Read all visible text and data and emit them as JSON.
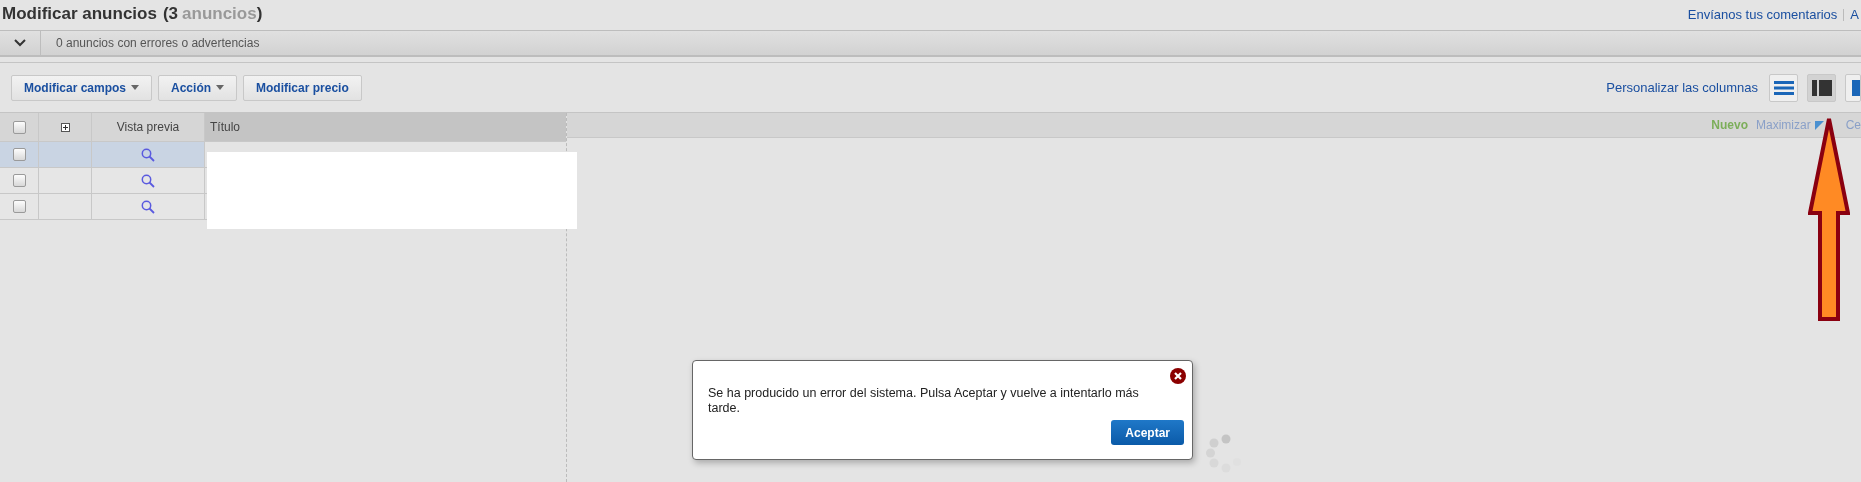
{
  "header": {
    "title": "Modificar anuncios",
    "count_open": "(3",
    "count_label": "anuncios",
    "count_close": ")",
    "links": [
      "Envíanos tus comentarios",
      "A"
    ]
  },
  "errors_bar": {
    "expanded": false,
    "text": "0 anuncios con errores o advertencias"
  },
  "toolbar": {
    "buttons": [
      {
        "label": "Modificar campos",
        "dropdown": true
      },
      {
        "label": "Acción",
        "dropdown": true
      },
      {
        "label": "Modificar precio",
        "dropdown": false
      }
    ],
    "customize_link": "Personalizar las columnas",
    "view_buttons": [
      {
        "kind": "rows",
        "selected": false
      },
      {
        "kind": "split",
        "selected": true
      },
      {
        "kind": "side",
        "selected": false
      }
    ]
  },
  "table": {
    "header_checked": false,
    "columns": [
      "Vista previa",
      "Título"
    ],
    "rows": [
      {
        "selected": true,
        "checked": false
      },
      {
        "selected": false,
        "checked": false
      },
      {
        "selected": false,
        "checked": false
      }
    ]
  },
  "detail_pane": {
    "new_label": "Nuevo",
    "maximize": "Maximizar",
    "close": "Ce"
  },
  "dialog": {
    "message": "Se ha producido un error del sistema. Pulsa Aceptar y vuelve a intentarlo más tarde.",
    "button": "Aceptar"
  }
}
